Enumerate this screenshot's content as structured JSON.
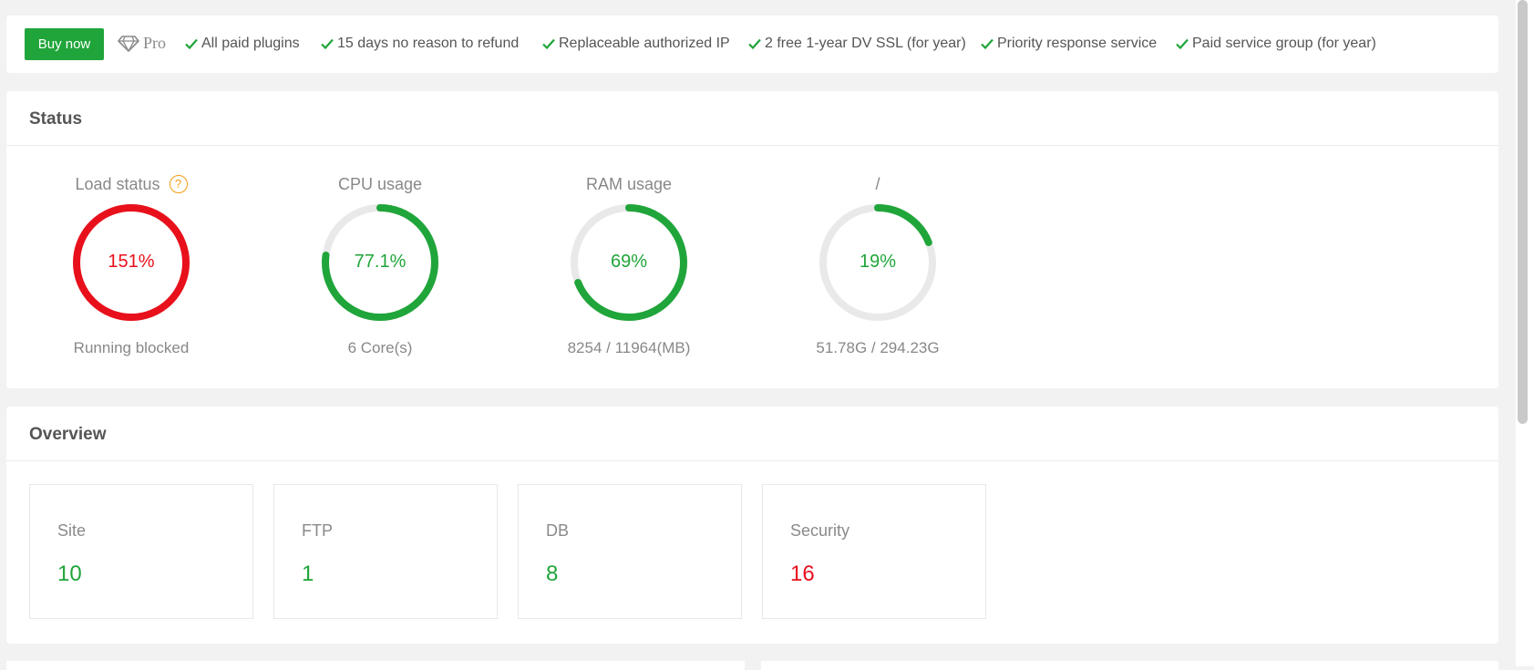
{
  "colors": {
    "accent_green": "#20a53a",
    "alert_red": "#e8101b",
    "track_gray": "#e9e9e9"
  },
  "promo": {
    "buy_label": "Buy now",
    "pro_label": "Pro",
    "pro_icon": "diamond-icon",
    "features": [
      "All paid plugins",
      "15 days no reason to refund",
      "Replaceable authorized IP",
      "2 free 1-year DV SSL (for year)",
      "Priority response service",
      "Paid service group (for year)"
    ]
  },
  "status": {
    "title": "Status",
    "gauges": [
      {
        "title": "Load status",
        "value": "151%",
        "percent": 100,
        "sub": "Running blocked",
        "color": "#e8101b",
        "help_icon": "help-icon",
        "help_label": "?"
      },
      {
        "title": "CPU usage",
        "value": "77.1%",
        "percent": 77.1,
        "sub": "6 Core(s)",
        "color": "#20a53a"
      },
      {
        "title": "RAM usage",
        "value": "69%",
        "percent": 69,
        "sub": "8254 / 11964(MB)",
        "color": "#20a53a"
      },
      {
        "title": "/",
        "value": "19%",
        "percent": 19,
        "sub": "51.78G / 294.23G",
        "color": "#20a53a"
      }
    ]
  },
  "overview": {
    "title": "Overview",
    "cards": [
      {
        "label": "Site",
        "value": "10",
        "color": "#20a53a"
      },
      {
        "label": "FTP",
        "value": "1",
        "color": "#20a53a"
      },
      {
        "label": "DB",
        "value": "8",
        "color": "#20a53a"
      },
      {
        "label": "Security",
        "value": "16",
        "color": "#e8101b"
      }
    ]
  }
}
